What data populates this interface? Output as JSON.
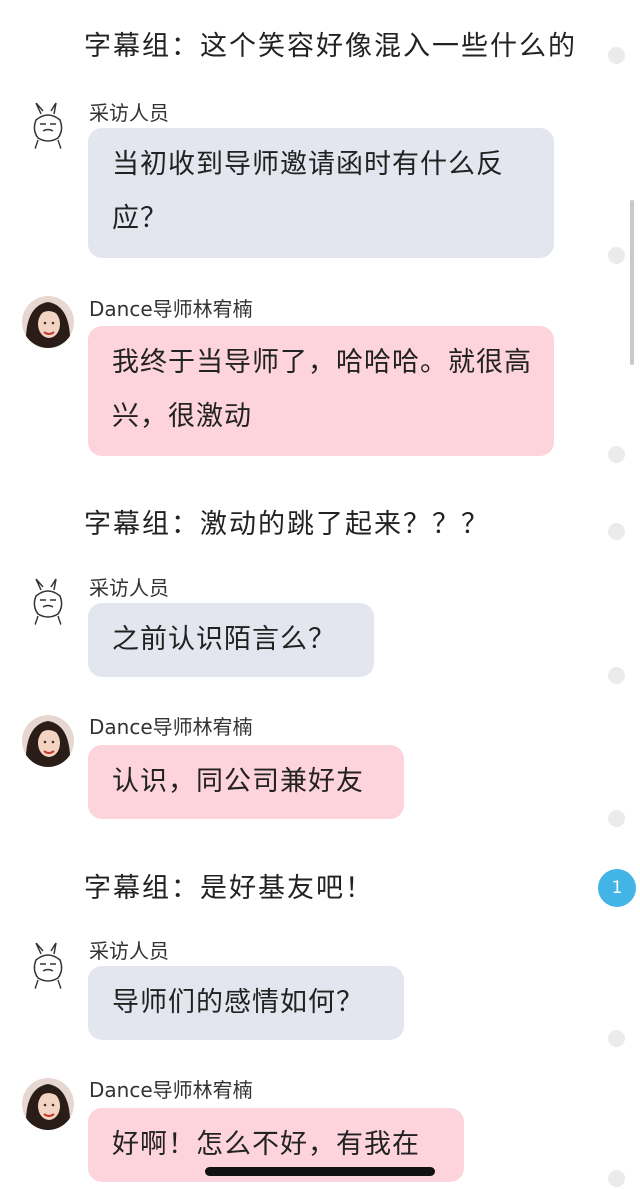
{
  "messages": {
    "caption_1": "字幕组：这个笑容好像混入一些什么的",
    "sender_1": "采访人员",
    "bubble_1": "当初收到导师邀请函时有什么反应？",
    "sender_2": "Dance导师林宥楠",
    "bubble_2": "我终于当导师了，哈哈哈。就很高兴，很激动",
    "caption_2": "字幕组：激动的跳了起来？？？",
    "sender_3": "采访人员",
    "bubble_3": "之前认识陌言么？",
    "sender_4": "Dance导师林宥楠",
    "bubble_4": "认识，同公司兼好友",
    "caption_3": "字幕组：是好基友吧！",
    "sender_5": "采访人员",
    "bubble_5": "导师们的感情如何？",
    "sender_6": "Dance导师林宥楠",
    "bubble_6": "好啊！怎么不好，有我在"
  },
  "badge": {
    "count": "1"
  },
  "colors": {
    "interviewer_bubble": "#e3e6ef",
    "mentor_bubble": "#fdd3dc",
    "badge": "#43b4e6",
    "status_dot": "#ebebeb"
  },
  "icons": {
    "interviewer_avatar": "rabbit-doodle-icon",
    "mentor_avatar": "person-avatar"
  }
}
